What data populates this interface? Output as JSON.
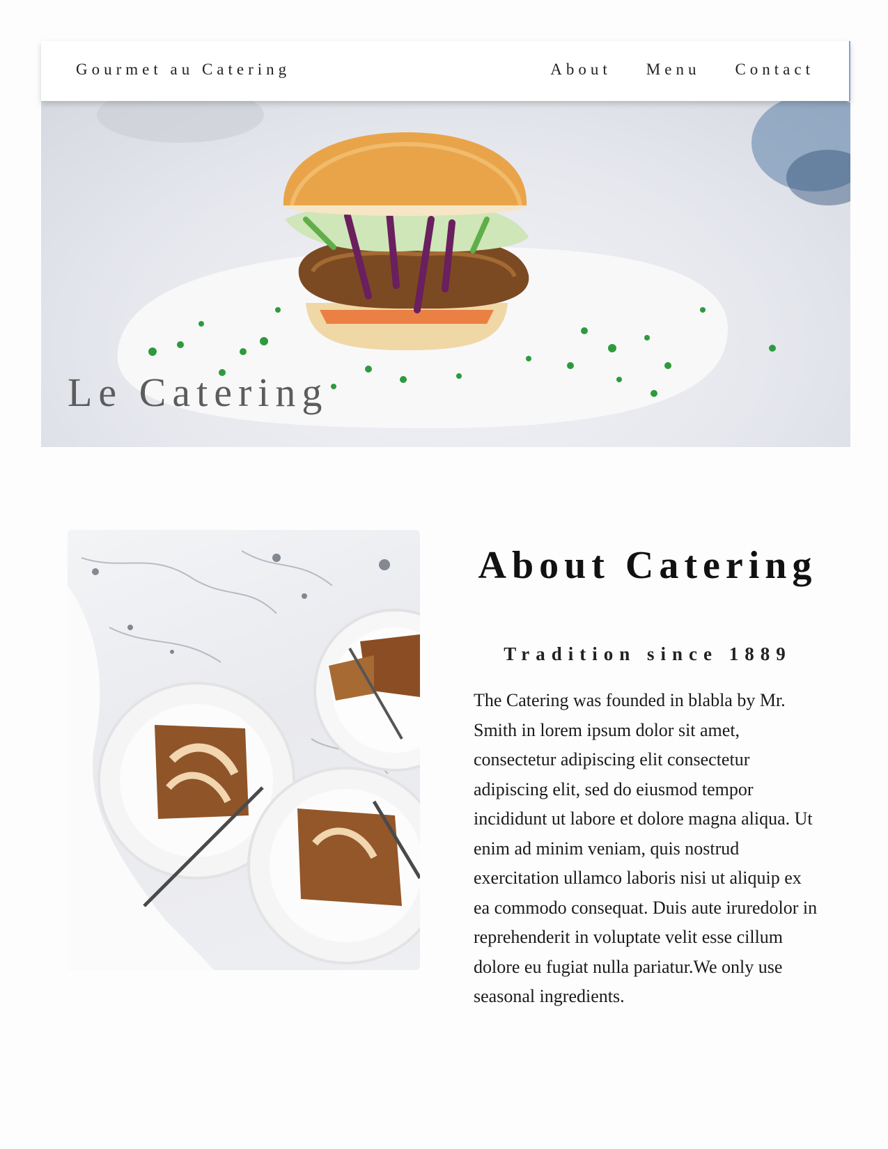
{
  "header": {
    "brand": "Gourmet au Catering",
    "nav": [
      {
        "label": "About"
      },
      {
        "label": "Menu"
      },
      {
        "label": "Contact"
      }
    ]
  },
  "hero": {
    "title": "Le Catering",
    "image_subject": "burger-photo"
  },
  "about": {
    "image_subject": "apple-cake-plates-photo",
    "title": "About Catering",
    "subtitle": "Tradition since 1889",
    "body": "The Catering was founded in blabla by Mr. Smith in lorem ipsum dolor sit amet, consectetur adipiscing elit consectetur adipiscing elit, sed do eiusmod tempor incididunt ut labore et dolore magna aliqua. Ut enim ad minim veniam, quis nostrud exercitation ullamco laboris nisi ut aliquip ex ea commodo consequat. Duis aute iruredolor in reprehenderit in voluptate velit esse cillum dolore eu fugiat nulla pariatur.We only use   seasonal   ingredients."
  },
  "colors": {
    "nav_text": "#222222",
    "hero_title": "#5c5c5c",
    "topbar_accent": "#7fa3c8"
  }
}
